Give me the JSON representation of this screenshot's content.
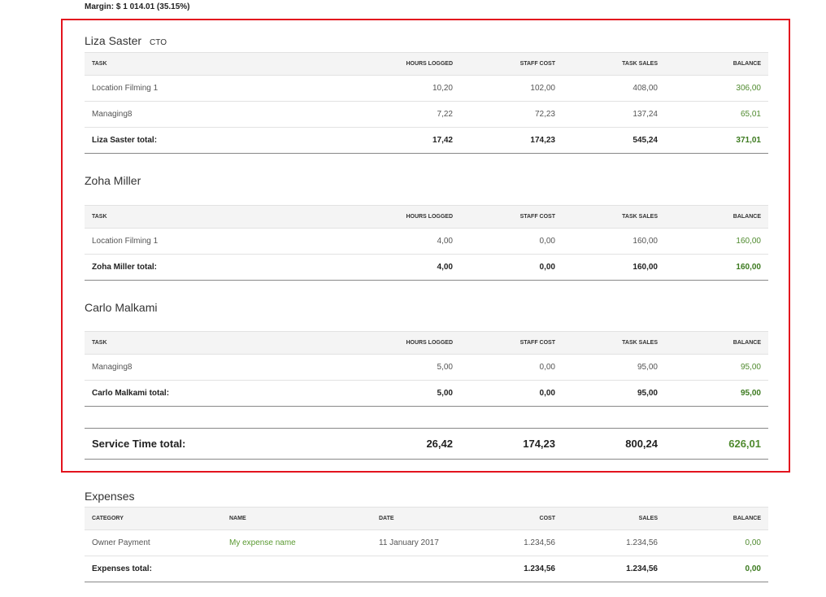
{
  "margin_line": "Margin: $ 1 014.01 (35.15%)",
  "service_columns": [
    "TASK",
    "HOURS LOGGED",
    "STAFF COST",
    "TASK SALES",
    "BALANCE"
  ],
  "people": [
    {
      "name": "Liza Saster",
      "role": "CTO",
      "rows": [
        {
          "task": "Location Filming 1",
          "hours": "10,20",
          "staff_cost": "102,00",
          "task_sales": "408,00",
          "balance": "306,00"
        },
        {
          "task": "Managing8",
          "hours": "7,22",
          "staff_cost": "72,23",
          "task_sales": "137,24",
          "balance": "65,01"
        }
      ],
      "total": {
        "label": "Liza Saster total:",
        "hours": "17,42",
        "staff_cost": "174,23",
        "task_sales": "545,24",
        "balance": "371,01"
      }
    },
    {
      "name": "Zoha Miller",
      "role": "",
      "rows": [
        {
          "task": "Location Filming 1",
          "hours": "4,00",
          "staff_cost": "0,00",
          "task_sales": "160,00",
          "balance": "160,00"
        }
      ],
      "total": {
        "label": "Zoha Miller total:",
        "hours": "4,00",
        "staff_cost": "0,00",
        "task_sales": "160,00",
        "balance": "160,00"
      }
    },
    {
      "name": "Carlo Malkami",
      "role": "",
      "rows": [
        {
          "task": "Managing8",
          "hours": "5,00",
          "staff_cost": "0,00",
          "task_sales": "95,00",
          "balance": "95,00"
        }
      ],
      "total": {
        "label": "Carlo Malkami total:",
        "hours": "5,00",
        "staff_cost": "0,00",
        "task_sales": "95,00",
        "balance": "95,00"
      }
    }
  ],
  "service_total": {
    "label": "Service Time total:",
    "hours": "26,42",
    "staff_cost": "174,23",
    "task_sales": "800,24",
    "balance": "626,01"
  },
  "expenses": {
    "title": "Expenses",
    "columns": [
      "CATEGORY",
      "NAME",
      "DATE",
      "COST",
      "SALES",
      "BALANCE"
    ],
    "rows": [
      {
        "category": "Owner Payment",
        "name": "My expense name",
        "date": "11 January 2017",
        "cost": "1.234,56",
        "sales": "1.234,56",
        "balance": "0,00"
      }
    ],
    "total": {
      "label": "Expenses total:",
      "cost": "1.234,56",
      "sales": "1.234,56",
      "balance": "0,00"
    }
  },
  "colors": {
    "highlight_border": "#e3141e",
    "balance_green": "#4f8a2e"
  }
}
